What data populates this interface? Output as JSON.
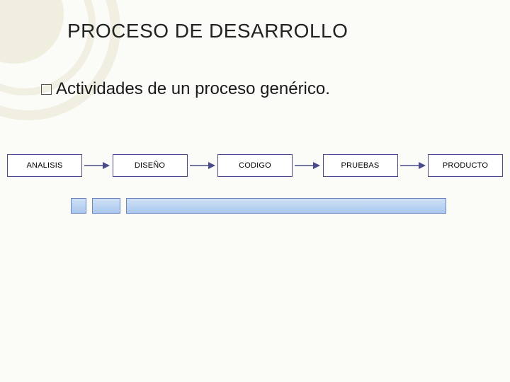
{
  "title": "PROCESO DE DESARROLLO",
  "bullet": "Actividades de un proceso genérico.",
  "flow": {
    "nodes": [
      "ANALISIS",
      "DISEÑO",
      "CODIGO",
      "PRUEBAS",
      "PRODUCTO"
    ]
  },
  "colors": {
    "node_border": "#4a4a8a",
    "bar_fill_top": "#cfe0f6",
    "bar_fill_bottom": "#aac8ee",
    "bar_border": "#6b86c2",
    "deco_tint": "rgba(200,190,130,0.18)"
  },
  "chart_data": {
    "type": "diagram",
    "title": "PROCESO DE DESARROLLO",
    "subtitle": "Actividades de un proceso genérico.",
    "nodes": [
      "ANALISIS",
      "DISEÑO",
      "CODIGO",
      "PRUEBAS",
      "PRODUCTO"
    ],
    "edges": [
      [
        "ANALISIS",
        "DISEÑO"
      ],
      [
        "DISEÑO",
        "CODIGO"
      ],
      [
        "CODIGO",
        "PRUEBAS"
      ],
      [
        "PRUEBAS",
        "PRODUCTO"
      ]
    ],
    "layout": "horizontal-linear"
  }
}
